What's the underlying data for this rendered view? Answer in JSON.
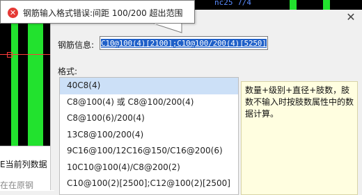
{
  "background": {
    "cad_top_text": "nc25 7/4",
    "table_row_text": "当前列数据",
    "table_row_prefix": "E",
    "table_row2_text": "在在原钢"
  },
  "dialog": {
    "close_icon": "close-icon",
    "info_label": "钢筋信息:",
    "info_value": "C10@100(4)[2100];C10@100/200(4)[5250]",
    "format_label": "格式:",
    "formats": [
      "40C8(4)",
      "C8@100(4) 或 C8@100/200(4)",
      "C8@100(6)/200(4)",
      "13C8@100/200(4)",
      "9C16@100/12C16@150/C16@200(6)",
      "10C10@100(4)/C8@200(2)",
      "C10@100(2)[2500];C12@100(2)[2500]"
    ],
    "selected_index": 0,
    "description": "数量+级别+直径+肢数，肢数不输入时按肢数属性中的数据计算。"
  },
  "tooltip": {
    "icon": "error-icon",
    "message": "钢筋输入格式错误:间距 100/200 超出范围"
  },
  "colors": {
    "selection": "#1e5fc8",
    "list_selected": "#cce0f7",
    "description_bg": "#fffee0",
    "error": "#e53935",
    "cad_green": "#22e22e"
  }
}
